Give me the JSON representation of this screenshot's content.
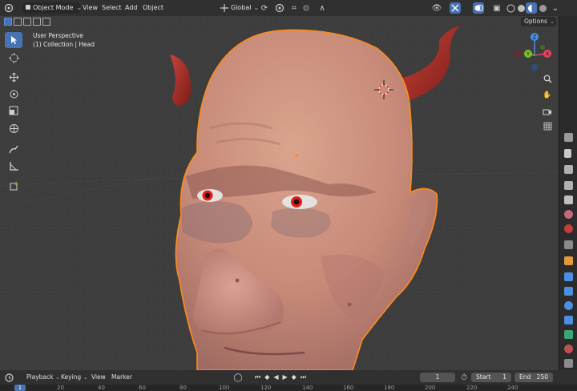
{
  "header": {
    "mode_label": "Object Mode",
    "menus": [
      "View",
      "Select",
      "Add",
      "Object"
    ],
    "orientation_label": "Global",
    "options_label": "Options"
  },
  "viewport": {
    "perspective_label": "User Perspective",
    "collection_label": "(1) Collection | Head"
  },
  "gizmo": {
    "axes": [
      "Z",
      "X",
      "Y"
    ]
  },
  "timeline": {
    "menus": [
      "Playback",
      "Keying",
      "View",
      "Marker"
    ],
    "current_frame": "1",
    "start_label": "Start",
    "start_value": "1",
    "end_label": "End",
    "end_value": "250"
  },
  "ruler": {
    "current": "1",
    "ticks": [
      "20",
      "40",
      "60",
      "80",
      "100",
      "120",
      "140",
      "160",
      "180",
      "200",
      "220",
      "240"
    ]
  },
  "colors": {
    "accent": "#4772b3",
    "selection_outline": "#ff8c1a",
    "axis_x": "#e8455a",
    "axis_y": "#7fbf2a",
    "axis_z": "#4a8fe0"
  }
}
